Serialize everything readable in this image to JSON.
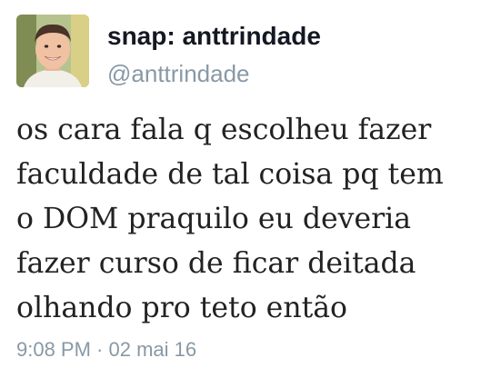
{
  "user": {
    "display_name": "snap: anttrindade",
    "handle": "@anttrindade",
    "avatar_icon": "profile-photo"
  },
  "tweet": {
    "lines": [
      "os cara fala q escolheu fazer",
      "faculdade de tal coisa pq tem",
      "o DOM praquilo eu deveria",
      "fazer curso de ficar deitada",
      "olhando pro teto então"
    ],
    "timestamp": "9:08 PM · 02 mai 16"
  },
  "colors": {
    "name": "#141823",
    "handle": "#8899a6",
    "text": "#222222",
    "background": "#ffffff"
  }
}
